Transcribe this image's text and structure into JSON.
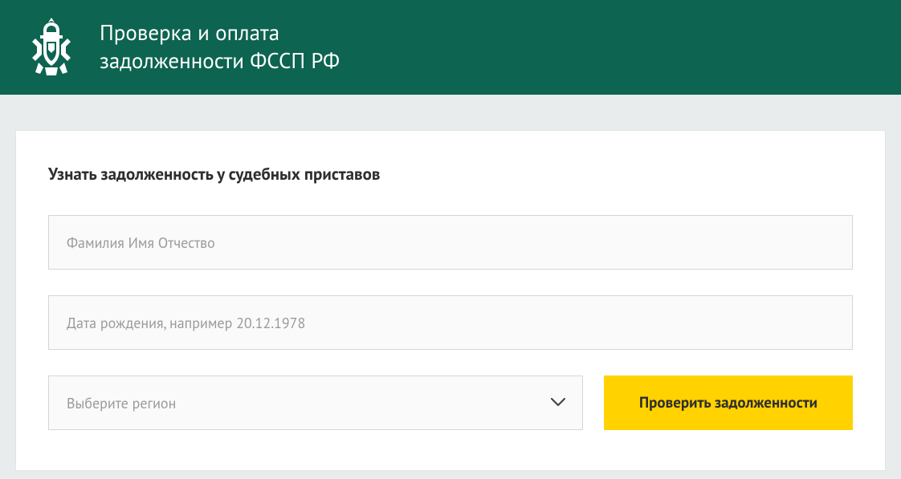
{
  "header": {
    "title_line1": "Проверка и оплата",
    "title_line2": "задолженности ФССП РФ"
  },
  "form": {
    "heading": "Узнать задолженность у судебных приставов",
    "name_placeholder": "Фамилия Имя Отчество",
    "name_value": "",
    "dob_placeholder": "Дата рождения, например 20.12.1978",
    "dob_value": "",
    "region_placeholder": "Выберите регион",
    "submit_label": "Проверить задолженности"
  },
  "colors": {
    "header_bg": "#0d6450",
    "button_bg": "#ffd200",
    "page_bg": "#e8ecec"
  }
}
